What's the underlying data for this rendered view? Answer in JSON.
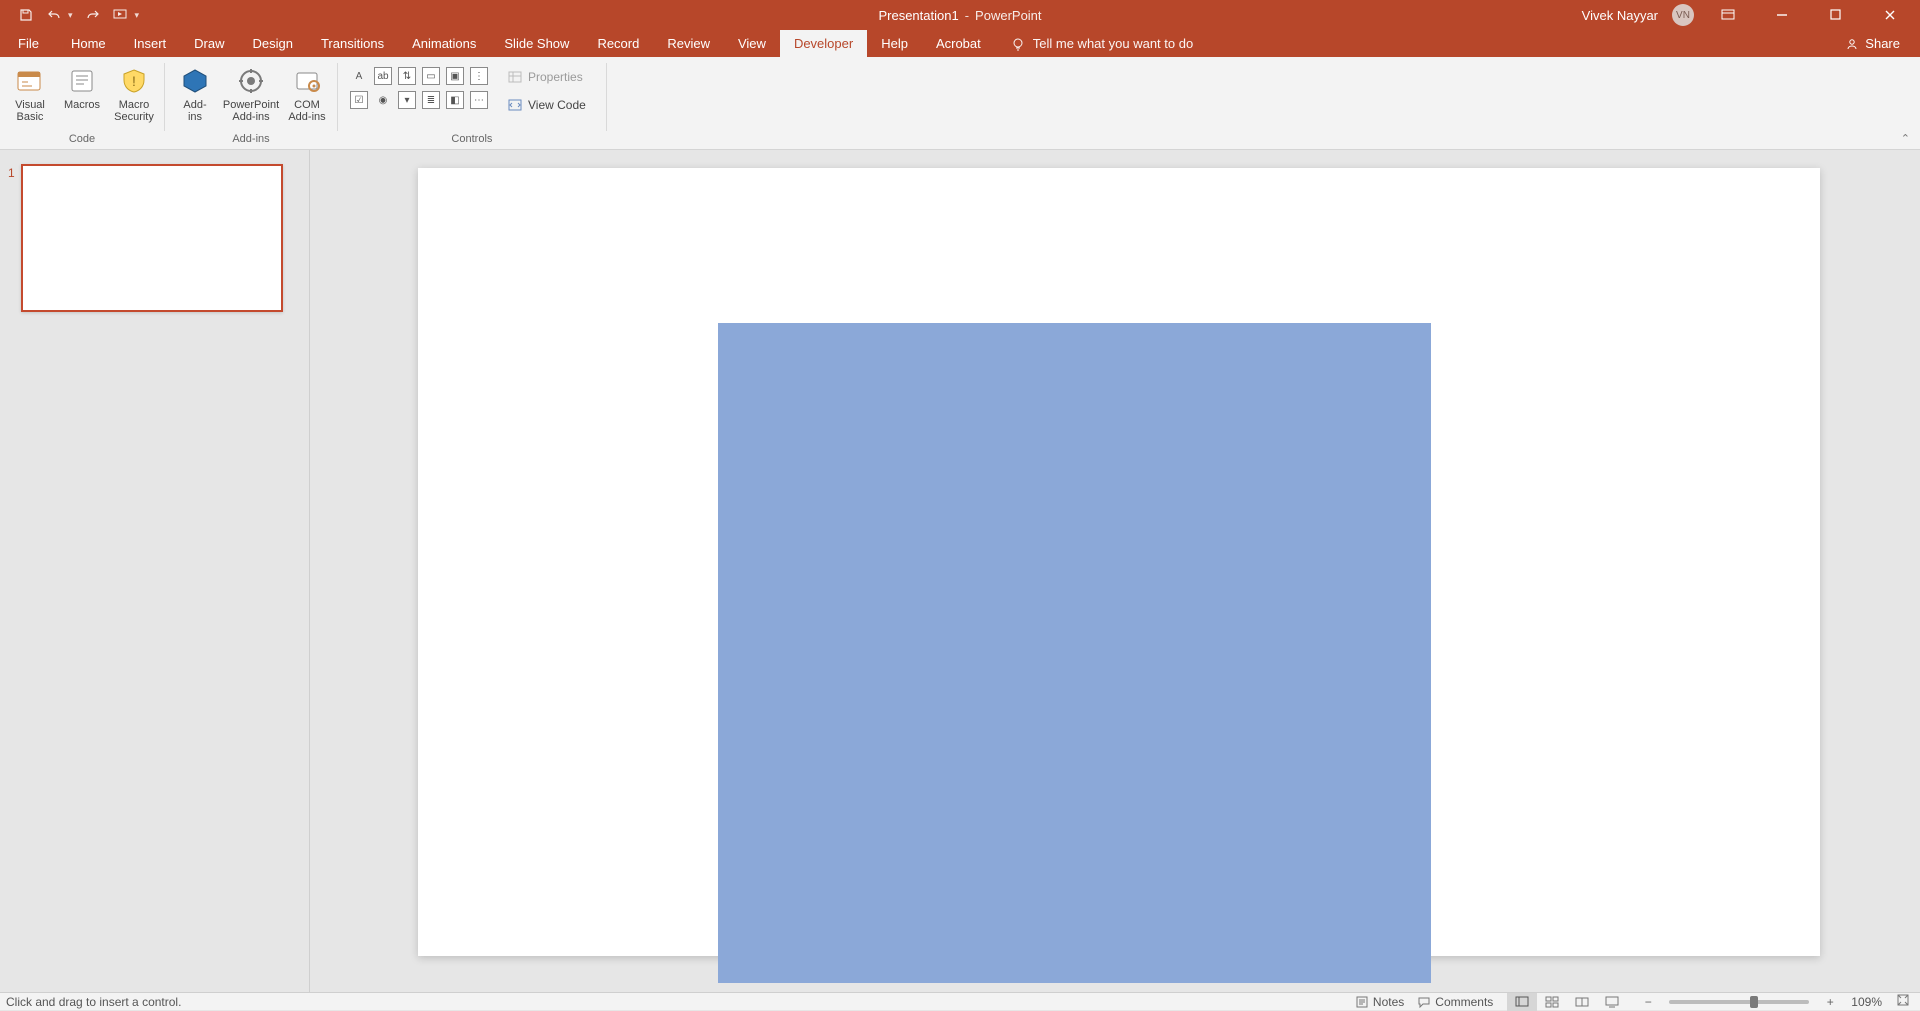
{
  "title": {
    "doc": "Presentation1",
    "app": "PowerPoint"
  },
  "user": {
    "name": "Vivek Nayyar",
    "initials": "VN"
  },
  "share_label": "Share",
  "tabs": [
    "File",
    "Home",
    "Insert",
    "Draw",
    "Design",
    "Transitions",
    "Animations",
    "Slide Show",
    "Record",
    "Review",
    "View",
    "Developer",
    "Help",
    "Acrobat"
  ],
  "active_tab": "Developer",
  "tellme": "Tell me what you want to do",
  "ribbon": {
    "code": {
      "visual_basic": "Visual\nBasic",
      "macros": "Macros",
      "macro_security": "Macro\nSecurity",
      "group": "Code"
    },
    "addins": {
      "addins": "Add-\nins",
      "ppt_addins": "PowerPoint\nAdd-ins",
      "com_addins": "COM\nAdd-ins",
      "group": "Add-ins"
    },
    "controls": {
      "properties": "Properties",
      "view_code": "View Code",
      "group": "Controls"
    }
  },
  "thumb": {
    "number": "1"
  },
  "status": {
    "left": "Click and drag to insert a control.",
    "notes": "Notes",
    "comments": "Comments",
    "zoom": "109%"
  }
}
